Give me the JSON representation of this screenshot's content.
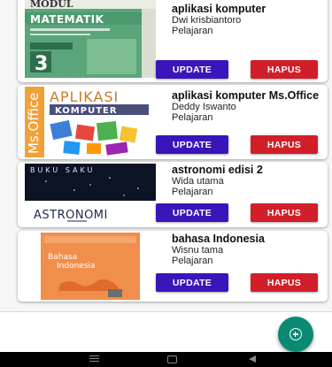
{
  "books": [
    {
      "title": "aplikasi komputer",
      "author": "Dwi krisbiantoro",
      "category": "Pelajaran",
      "cover_text": [
        "MODUL",
        "MATEMATIK",
        "3"
      ]
    },
    {
      "title": "aplikasi komputer Ms.Office",
      "author": "Deddy Iswanto",
      "category": "Pelajaran",
      "cover_text": [
        "APLIKASI",
        "KOMPUTER",
        "Ms.Office"
      ]
    },
    {
      "title": "astronomi edisi 2",
      "author": "Wida utama",
      "category": "Pelajaran",
      "cover_text": [
        "BUKU SAKU",
        "ASTRONOMI"
      ]
    },
    {
      "title": "bahasa Indonesia",
      "author": "Wisnu tama",
      "category": "Pelajaran",
      "cover_text": [
        "Bahasa",
        "Indonesia"
      ]
    }
  ],
  "buttons": {
    "update": "UPDATE",
    "hapus": "HAPUS"
  },
  "colors": {
    "update_button": "#3a16ba",
    "hapus_button": "#d11f2a",
    "fab": "#0a8a72",
    "nav_bar": "#000000"
  },
  "fab": {
    "icon": "add-circle-icon"
  },
  "nav_bar": {
    "icons": [
      "menu-icon",
      "home-icon",
      "back-icon"
    ]
  }
}
